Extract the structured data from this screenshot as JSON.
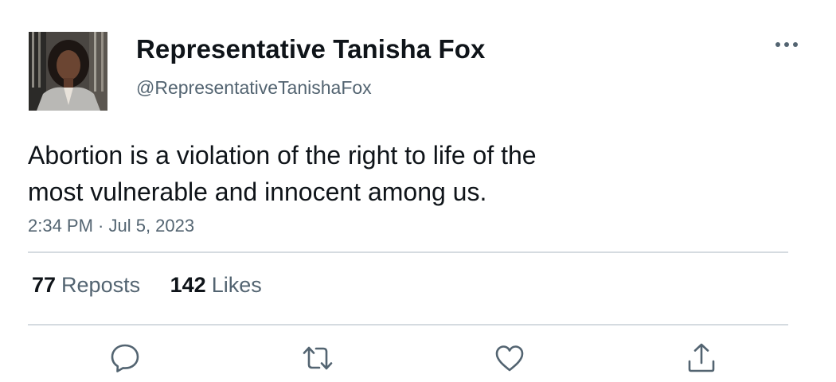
{
  "author": {
    "name": "Representative Tanisha Fox",
    "handle": "@RepresentativeTanishaFox"
  },
  "tweet": {
    "text": "Abortion is a violation of the right to life of the\nmost vulnerable and innocent among us.",
    "timestamp": "2:34 PM · Jul 5, 2023"
  },
  "stats": {
    "reposts_count": "77",
    "reposts_label": "Reposts",
    "likes_count": "142",
    "likes_label": "Likes"
  },
  "icons": {
    "more": "more-dots-icon",
    "reply": "reply-icon",
    "repost": "repost-icon",
    "like": "heart-icon",
    "share": "share-icon"
  },
  "colors": {
    "text_primary": "#0f1419",
    "text_secondary": "#536471",
    "divider": "#d5dbe0"
  }
}
